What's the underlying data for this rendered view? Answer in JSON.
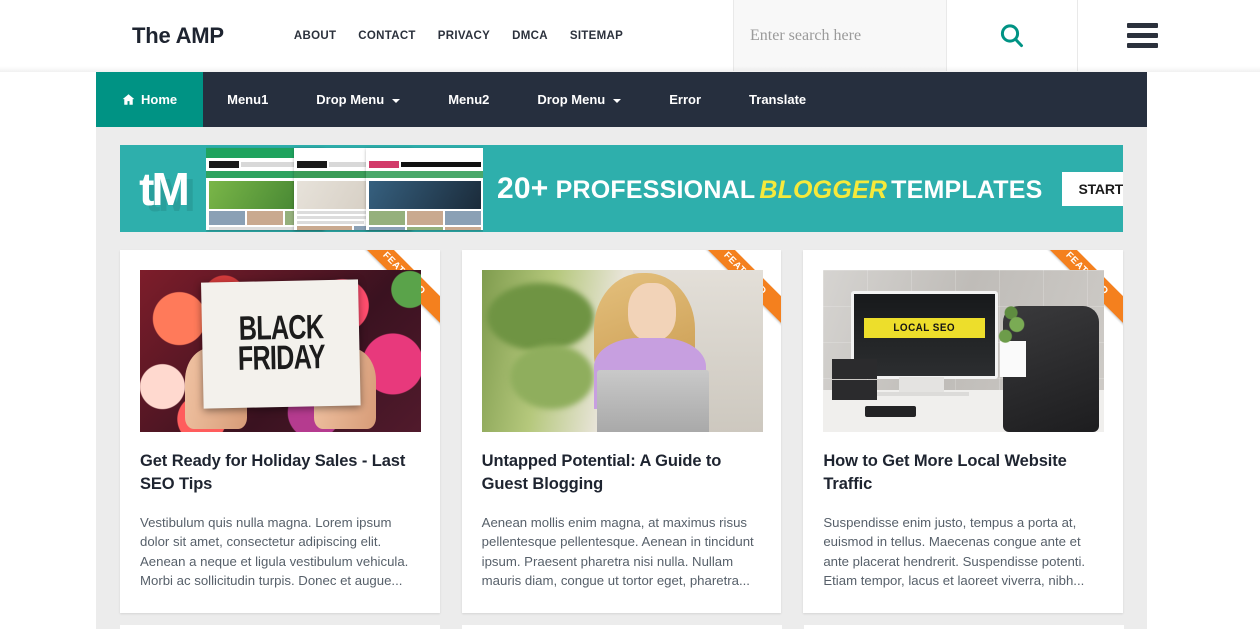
{
  "header": {
    "brand": "The AMP",
    "top_links": [
      {
        "label": "ABOUT"
      },
      {
        "label": "CONTACT"
      },
      {
        "label": "PRIVACY"
      },
      {
        "label": "DMCA"
      },
      {
        "label": "SITEMAP"
      }
    ],
    "search": {
      "placeholder": "Enter search here",
      "value": "",
      "icon": "search-icon"
    },
    "menu_icon": "hamburger-menu-icon"
  },
  "nav": {
    "items": [
      {
        "label": "Home",
        "icon": "home-icon",
        "active": true,
        "dropdown": false
      },
      {
        "label": "Menu1",
        "active": false,
        "dropdown": false
      },
      {
        "label": "Drop Menu",
        "active": false,
        "dropdown": true
      },
      {
        "label": "Menu2",
        "active": false,
        "dropdown": false
      },
      {
        "label": "Drop Menu",
        "active": false,
        "dropdown": true
      },
      {
        "label": "Error",
        "active": false,
        "dropdown": false
      },
      {
        "label": "Translate",
        "active": false,
        "dropdown": false
      }
    ]
  },
  "banner": {
    "logo_text": "tM",
    "count": "20+",
    "text_before": "PROFESSIONAL",
    "highlight": "BLOGGER",
    "text_after": "TEMPLATES",
    "cta_label": "START NOW",
    "bg_color": "#2eafac",
    "highlight_color": "#f5e93b"
  },
  "posts": [
    {
      "ribbon": "FEATURED",
      "title": "Get Ready for Holiday Sales - Last SEO Tips",
      "excerpt": "Vestibulum quis nulla magna. Lorem ipsum dolor sit amet, consectetur adipiscing elit. Aenean a neque et ligula vestibulum vehicula. Morbi ac sollicitudin turpis. Donec et augue...",
      "image_alt": "BLACK FRIDAY sign held by hands over bokeh lights",
      "image_text_line1": "BLACK",
      "image_text_line2": "FRIDAY"
    },
    {
      "ribbon": "FEATURED",
      "title": "Untapped Potential: A Guide to Guest Blogging",
      "excerpt": "Aenean mollis enim magna, at maximus risus pellentesque pellentesque. Aenean in tincidunt ipsum. Praesent pharetra nisi nulla. Nullam mauris diam, congue ut tortor eget, pharetra...",
      "image_alt": "Woman on a sofa using a laptop outdoors"
    },
    {
      "ribbon": "FEATURED",
      "title": "How to Get More Local Website Traffic",
      "excerpt": "Suspendisse enim justo, tempus a porta at, euismod in tellus. Maecenas congue ante et ante placerat hendrerit. Suspendisse potenti. Etiam tempor, lacus et laoreet viverra, nibh...",
      "image_alt": "Desktop monitor on a desk showing a LOCAL SEO banner",
      "image_text": "LOCAL SEO"
    }
  ],
  "theme": {
    "accent_teal": "#009384",
    "nav_dark": "#262f3e",
    "content_bg": "#ececec",
    "ribbon_orange": "#f4801e",
    "card_bg": "#ffffff"
  }
}
